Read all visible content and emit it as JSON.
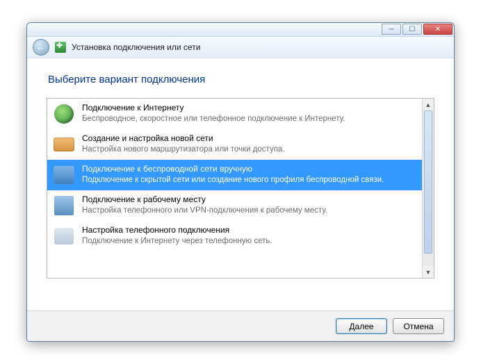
{
  "navbar": {
    "title": "Установка подключения или сети"
  },
  "heading": "Выберите вариант подключения",
  "options": [
    {
      "title": "Подключение к Интернету",
      "subtitle": "Беспроводное, скоростное или телефонное подключение к Интернету."
    },
    {
      "title": "Создание и настройка новой сети",
      "subtitle": "Настройка нового маршрутизатора или точки доступа."
    },
    {
      "title": "Подключение к беспроводной сети вручную",
      "subtitle": "Подключение к скрытой сети или создание нового профиля беспроводной связи."
    },
    {
      "title": "Подключение к рабочему месту",
      "subtitle": "Настройка телефонного или VPN-подключения к рабочему месту."
    },
    {
      "title": "Настройка телефонного подключения",
      "subtitle": "Подключение к Интернету через телефонную сеть."
    }
  ],
  "buttons": {
    "next": "Далее",
    "cancel": "Отмена"
  }
}
